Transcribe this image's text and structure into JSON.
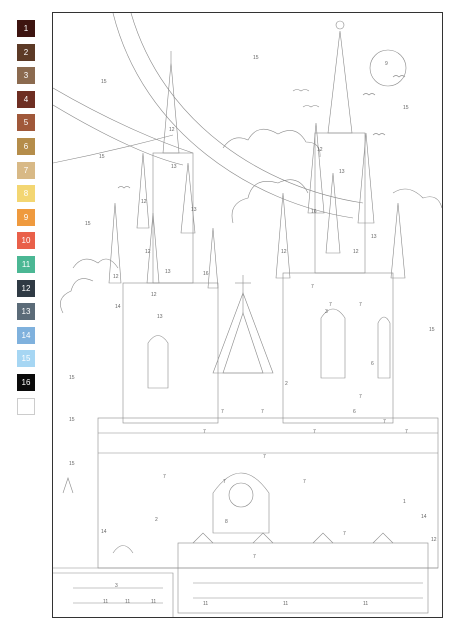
{
  "palette": [
    {
      "label": "1",
      "color": "#3d1410"
    },
    {
      "label": "2",
      "color": "#5c3a26"
    },
    {
      "label": "3",
      "color": "#8b6a4f"
    },
    {
      "label": "4",
      "color": "#6e2e22"
    },
    {
      "label": "5",
      "color": "#a0583a"
    },
    {
      "label": "6",
      "color": "#b58d4a"
    },
    {
      "label": "7",
      "color": "#d8b986"
    },
    {
      "label": "8",
      "color": "#f3d672"
    },
    {
      "label": "9",
      "color": "#ef9a3e"
    },
    {
      "label": "10",
      "color": "#e9604a"
    },
    {
      "label": "11",
      "color": "#4bb794"
    },
    {
      "label": "12",
      "color": "#2f3a44"
    },
    {
      "label": "13",
      "color": "#5b6b78"
    },
    {
      "label": "14",
      "color": "#7fb1dd"
    },
    {
      "label": "15",
      "color": "#a6d6f3"
    },
    {
      "label": "16",
      "color": "#0a0a0a"
    },
    {
      "label": "",
      "color": "#ffffff"
    }
  ],
  "canvas": {
    "region_labels": [
      {
        "text": "15"
      },
      {
        "text": "9"
      },
      {
        "text": "15"
      },
      {
        "text": "15"
      },
      {
        "text": "15"
      },
      {
        "text": "15"
      },
      {
        "text": "15"
      },
      {
        "text": "15"
      },
      {
        "text": "15"
      },
      {
        "text": "15"
      },
      {
        "text": "12"
      },
      {
        "text": "13"
      },
      {
        "text": "12"
      },
      {
        "text": "13"
      },
      {
        "text": "12"
      },
      {
        "text": "13"
      },
      {
        "text": "16"
      },
      {
        "text": "12"
      },
      {
        "text": "13"
      },
      {
        "text": "16"
      },
      {
        "text": "12"
      },
      {
        "text": "13"
      },
      {
        "text": "12"
      },
      {
        "text": "12"
      },
      {
        "text": "14"
      },
      {
        "text": "12"
      },
      {
        "text": "13"
      },
      {
        "text": "7"
      },
      {
        "text": "7"
      },
      {
        "text": "7"
      },
      {
        "text": "6"
      },
      {
        "text": "7"
      },
      {
        "text": "3"
      },
      {
        "text": "2"
      },
      {
        "text": "7"
      },
      {
        "text": "7"
      },
      {
        "text": "7"
      },
      {
        "text": "7"
      },
      {
        "text": "7"
      },
      {
        "text": "7"
      },
      {
        "text": "7"
      },
      {
        "text": "7"
      },
      {
        "text": "6"
      },
      {
        "text": "7"
      },
      {
        "text": "7"
      },
      {
        "text": "14"
      },
      {
        "text": "14"
      },
      {
        "text": "8"
      },
      {
        "text": "11"
      },
      {
        "text": "11"
      },
      {
        "text": "11"
      },
      {
        "text": "11"
      },
      {
        "text": "11"
      },
      {
        "text": "11"
      },
      {
        "text": "1"
      },
      {
        "text": "12"
      },
      {
        "text": "3"
      },
      {
        "text": "7"
      },
      {
        "text": "2"
      },
      {
        "text": "7"
      }
    ]
  }
}
